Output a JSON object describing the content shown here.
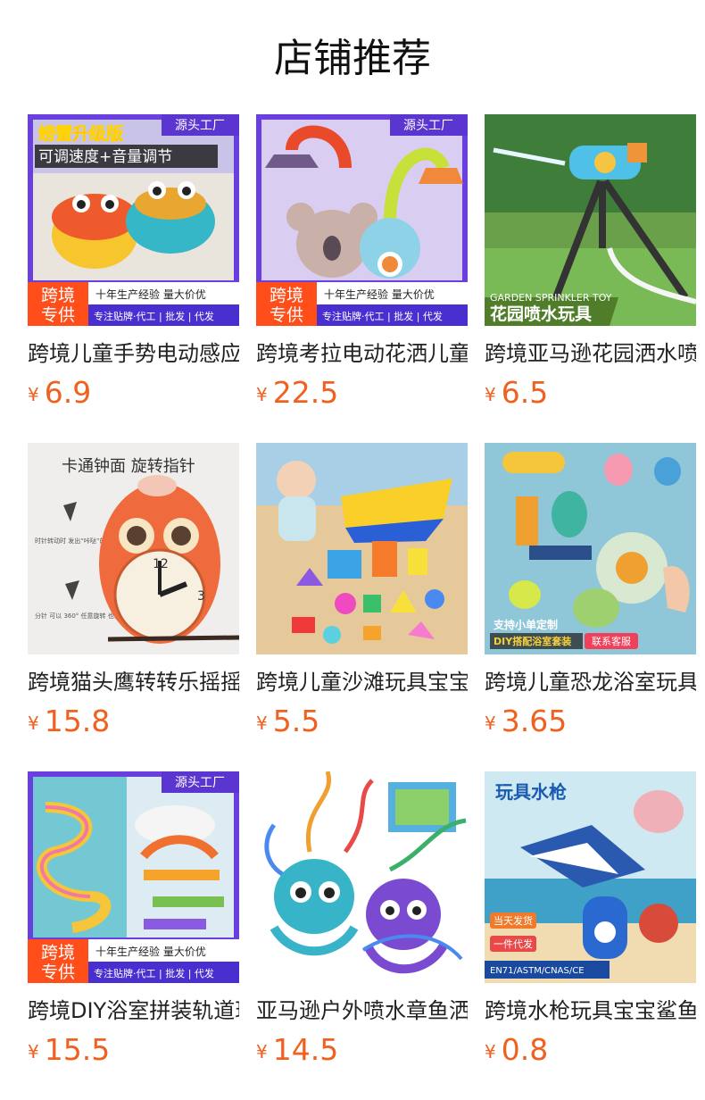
{
  "shop": {
    "title": "店铺推荐"
  },
  "currency_symbol": "¥",
  "products": [
    {
      "name": "跨境儿童手势电动感应螃蟹玩具",
      "price": "6.9",
      "image": {
        "tag": "源头工厂",
        "headline": "螃蟹升级版",
        "subline": "可调速度+音量调节",
        "badge_top": "跨境",
        "badge_bottom": "专供",
        "strip_top": "十年生产经验  量大价优",
        "strip_bottom": "专注贴牌·代工 | 批发 | 代发"
      }
    },
    {
      "name": "跨境考拉电动花洒儿童戏水玩具",
      "price": "22.5",
      "image": {
        "tag": "源头工厂",
        "badge_top": "跨境",
        "badge_bottom": "专供",
        "strip_top": "十年生产经验  量大价优",
        "strip_bottom": "专注贴牌·代工 | 批发 | 代发"
      }
    },
    {
      "name": "跨境亚马逊花园洒水喷水玩具",
      "price": "6.5",
      "image": {
        "caption_en": "GARDEN SPRINKLER TOY",
        "caption_cn": "花园喷水玩具"
      }
    },
    {
      "name": "跨境猫头鹰转转乐摇摇乐玩具",
      "price": "15.8",
      "image": {
        "headline": "卡通钟面  旋转指针",
        "note1": "时针转动时 发出“咔哒”的声音",
        "note2": "分针 可以 360° 任意旋转 也会随着水流旋转"
      }
    },
    {
      "name": "跨境儿童沙滩玩具宝宝挖沙套装",
      "price": "5.5",
      "image": {}
    },
    {
      "name": "跨境儿童恐龙浴室玩具套装",
      "price": "3.65",
      "image": {
        "line1": "支持小单定制",
        "line2": "DIY搭配浴室套装",
        "button": "联系客服"
      }
    },
    {
      "name": "跨境DIY浴室拼装轨道玩具",
      "price": "15.5",
      "image": {
        "tag": "源头工厂",
        "badge_top": "跨境",
        "badge_bottom": "专供",
        "strip_top": "十年生产经验  量大价优",
        "strip_bottom": "专注贴牌·代工 | 批发 | 代发"
      }
    },
    {
      "name": "亚马逊户外喷水章鱼洒水玩具",
      "price": "14.5",
      "image": {}
    },
    {
      "name": "跨境水枪玩具宝宝鲨鱼戏水玩具",
      "price": "0.8",
      "image": {
        "headline": "玩具水枪",
        "tag1": "当天发货",
        "tag2": "一件代发",
        "cert": "EN71/ASTM/CNAS/CE"
      }
    }
  ]
}
